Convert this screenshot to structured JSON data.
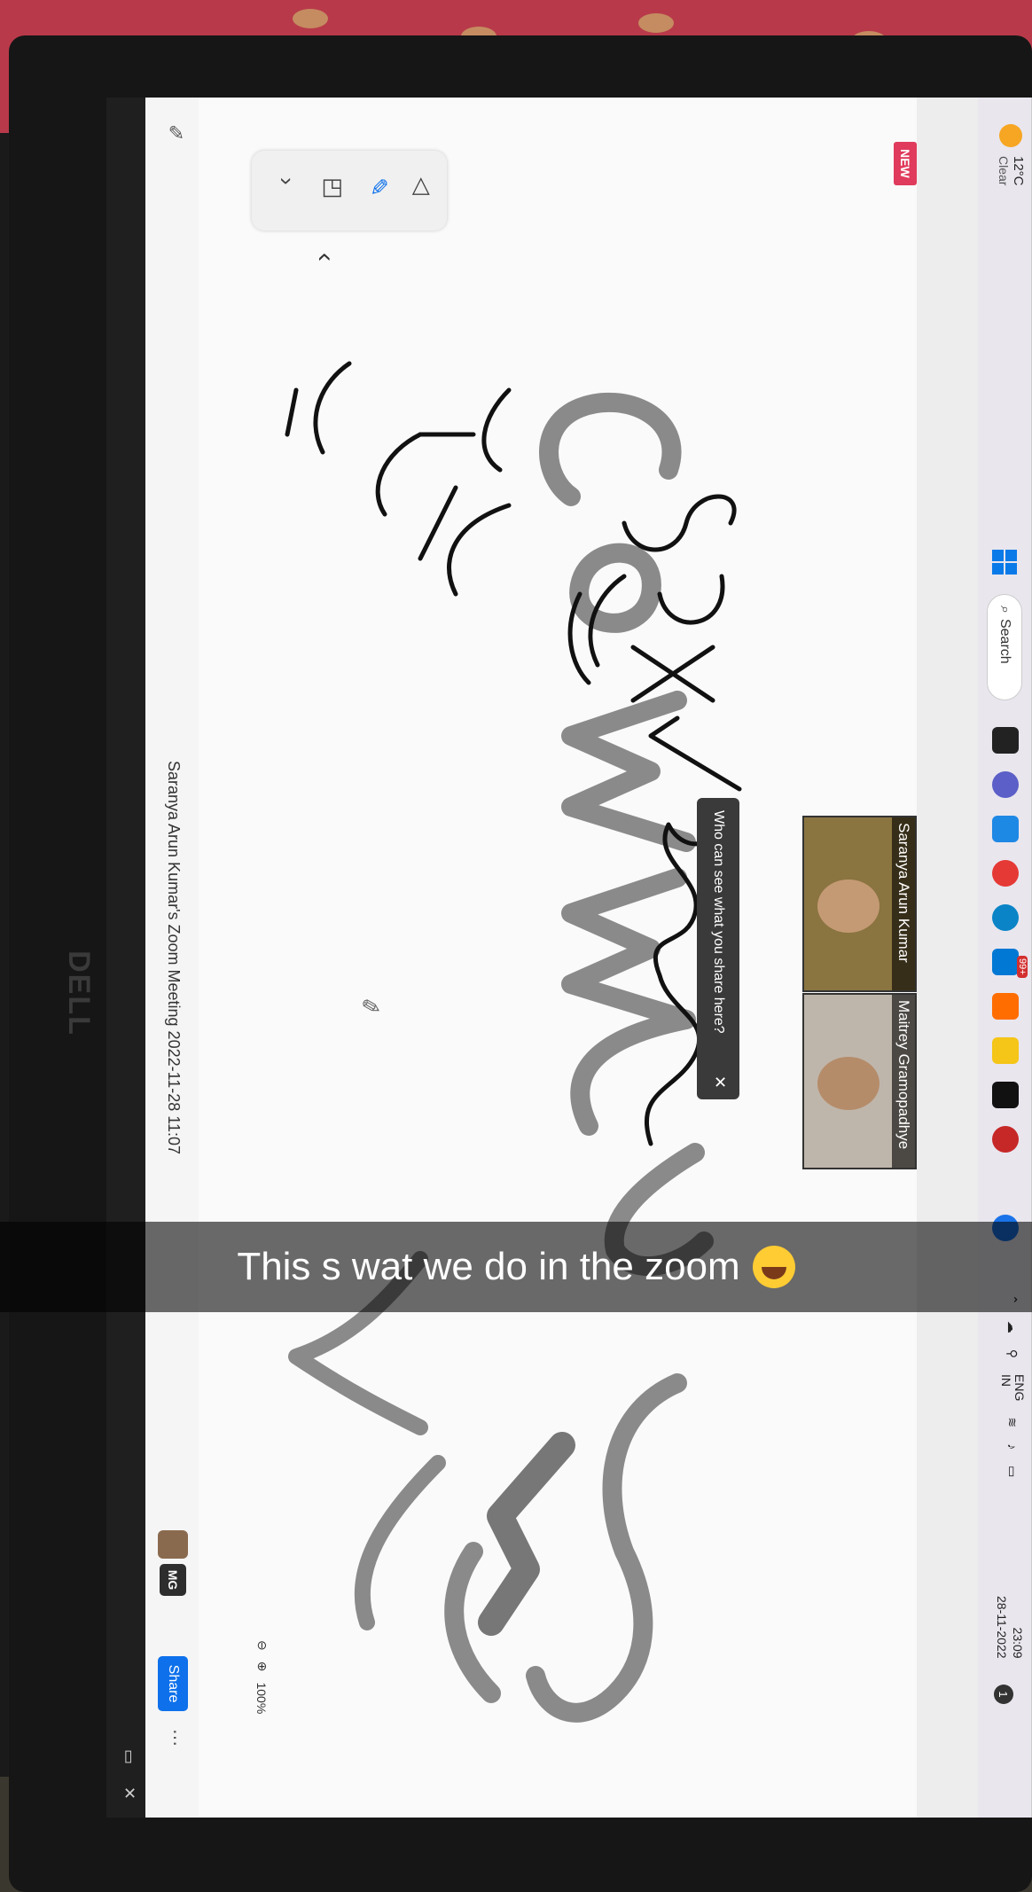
{
  "meeting": {
    "title": "Saranya Arun Kumar's Zoom Meeting 2022-11-28 11:07",
    "share_label": "Share",
    "user_initials": "MG",
    "new_badge": "NEW",
    "zoom_level": "100%"
  },
  "participants": [
    {
      "name": "Saranya Arun Kumar"
    },
    {
      "name": "Maitrey Gramopadhye"
    }
  ],
  "popup": {
    "text": "Who can see what you share here?",
    "close": "✕"
  },
  "taskbar": {
    "weather_temp": "12°C",
    "weather_condition": "Clear",
    "search_label": "Search",
    "badge_count": "99+",
    "lang_top": "ENG",
    "lang_bottom": "IN",
    "time": "23:09",
    "date": "28-11-2022",
    "notification_count": "1"
  },
  "device": {
    "brand": "DELL"
  },
  "caption": {
    "text": "This s wat we do in the zoom"
  },
  "colors": {
    "zoom_blue": "#0e71eb",
    "new_badge": "#e03b5c",
    "fabric": "#b83a4a",
    "ink_black": "#111111",
    "ink_gray": "#8a8a8a"
  },
  "icons": [
    "whiteboard-icon",
    "more-icon",
    "select-icon",
    "pen-icon",
    "shapes-icon",
    "chevron-left-icon",
    "pencil-icon",
    "windows-icon",
    "search-icon",
    "edge-icon",
    "chrome-icon",
    "mail-icon",
    "files-icon",
    "wifi-icon",
    "volume-icon",
    "battery-icon"
  ]
}
